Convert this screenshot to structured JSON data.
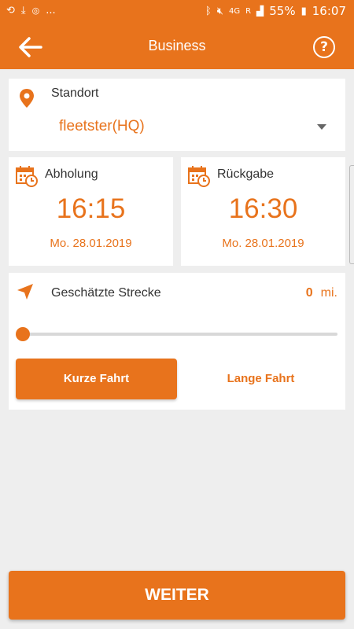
{
  "status_bar": {
    "left_icons": [
      "sync-icon",
      "download-icon",
      "app-icon"
    ],
    "more": "...",
    "net_type": "4G",
    "net_r": "R",
    "battery": "55%",
    "time": "16:07"
  },
  "header": {
    "title": "Business"
  },
  "location": {
    "label": "Standort",
    "value": "fleetster(HQ)"
  },
  "pickup": {
    "label": "Abholung",
    "time": "16:15",
    "date": "Mo. 28.01.2019"
  },
  "return": {
    "label": "Rückgabe",
    "time": "16:30",
    "date": "Mo. 28.01.2019"
  },
  "route": {
    "label": "Geschätzte Strecke",
    "distance": "0",
    "unit": "mi.",
    "slider_level": 0,
    "short_trip": "Kurze Fahrt",
    "long_trip": "Lange Fahrt"
  },
  "footer": {
    "continue": "WEITER"
  },
  "colors": {
    "accent": "#e8731c",
    "background": "#eeeeee"
  }
}
